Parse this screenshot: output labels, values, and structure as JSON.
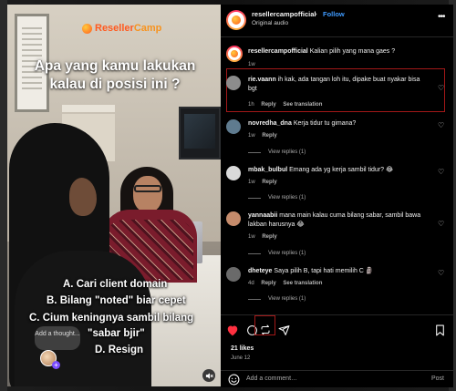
{
  "post": {
    "username": "resellercampofficial",
    "follow_label": "Follow",
    "separator": "•",
    "audio": "Original audio"
  },
  "video": {
    "brand_part1": "Reseller",
    "brand_part2": "Camp",
    "headline": "Apa yang kamu lakukan kalau di posisi ini ?",
    "options": [
      "A. Cari client domain",
      "B. Bilang \"noted\" biar cepet",
      "C. Cium keningnya sambil bilang",
      "\"sabar bjir\"",
      "D. Resign"
    ],
    "thought_placeholder": "Add a thought...",
    "thought_plus": "+"
  },
  "comments": [
    {
      "username": "resellercampofficial",
      "text": "Kalian pilih yang mana gaes ?",
      "time": "1w",
      "avatar_color": "#ffffff"
    },
    {
      "username": "rie.vaann",
      "text": "ih kak, ada tangan loh itu, dipake buat nyakar bisa bgt",
      "time": "1h",
      "reply": "Reply",
      "see_translation": "See translation",
      "avatar_color": "#8c8c8c"
    },
    {
      "username": "novredha_dna",
      "text": "Kerja tidur tu gimana?",
      "time": "1w",
      "reply": "Reply",
      "view_replies": "View replies (1)",
      "avatar_color": "#5f7b8f"
    },
    {
      "username": "mbak_bulbul",
      "text": "Emang ada yg kerja sambil tidur? 😂",
      "time": "1w",
      "reply": "Reply",
      "view_replies": "View replies (1)",
      "avatar_color": "#d9d9d9"
    },
    {
      "username": "yannaabii",
      "text": "mana main kalau cuma bilang sabar, sambil bawa lakban harusnya 😂",
      "time": "1w",
      "reply": "Reply",
      "view_replies": "View replies (1)",
      "avatar_color": "#c58b6b"
    },
    {
      "username": "dheteye",
      "text": "Saya pilih B, tapi hati memilih C 🗿",
      "time": "4d",
      "reply": "Reply",
      "see_translation": "See translation",
      "view_replies": "View replies (1)",
      "avatar_color": "#6a6a6a"
    }
  ],
  "actions": {
    "likes": "21 likes",
    "date": "June 12",
    "add_comment_placeholder": "Add a comment…",
    "post_label": "Post",
    "heart_color": "#ff3040"
  },
  "colors": {
    "follow": "#3f9bff",
    "highlight_border": "#a31818",
    "brand": "#ff5a1f"
  }
}
